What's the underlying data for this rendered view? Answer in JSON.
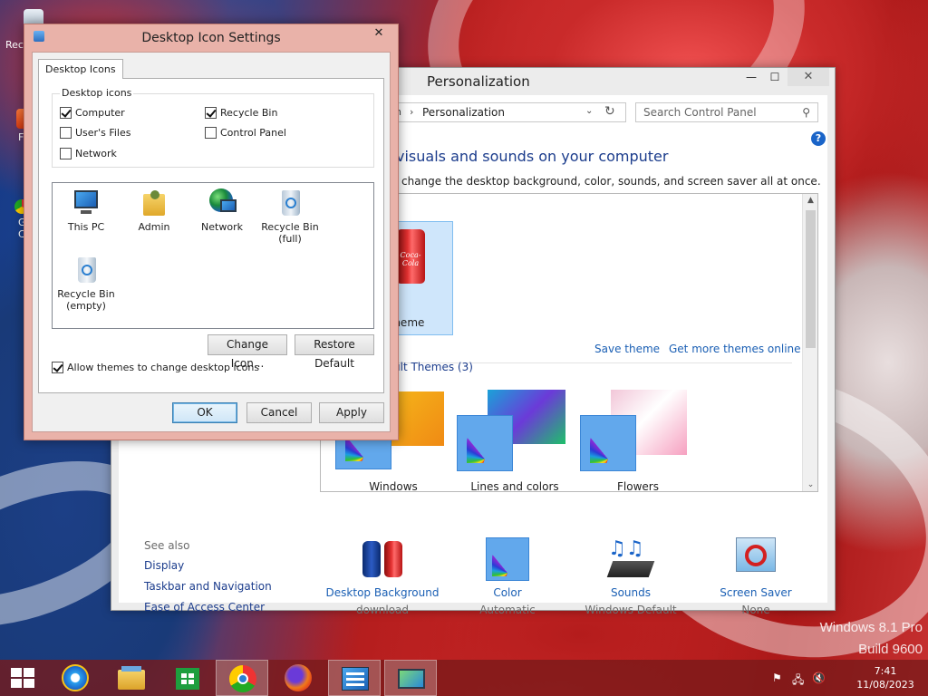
{
  "wallpaper": {
    "watermark_line1": "Windows 8.1 Pro",
    "watermark_line2": "Build 9600"
  },
  "desktop_icons": [
    {
      "label": "Rec",
      "icon": "recycle-bin-icon"
    },
    {
      "label": "F",
      "icon": "app-icon"
    },
    {
      "label": "G C",
      "icon": "chrome-icon"
    }
  ],
  "personalization": {
    "title": "Personalization",
    "window_controls": {
      "minimize": "—",
      "maximize": "☐",
      "close": "✕"
    },
    "address_prefix": "n",
    "address_sep": "›",
    "address_current": "Personalization",
    "search_placeholder": "Search Control Panel",
    "help": "?",
    "heading": "visuals and sounds on your computer",
    "subheading": "change the desktop background, color, sounds, and screen saver all at once.",
    "my_themes_caption": "Theme",
    "save_theme": "Save theme",
    "get_more_themes": "Get more themes online",
    "default_themes_heading": "ult Themes (3)",
    "themes": [
      {
        "name": "Windows"
      },
      {
        "name": "Lines and colors"
      },
      {
        "name": "Flowers"
      }
    ],
    "see_also": {
      "heading": "See also",
      "links": [
        "Display",
        "Taskbar and Navigation",
        "Ease of Access Center"
      ]
    },
    "bottom": [
      {
        "title": "Desktop Background",
        "sub": "download",
        "icon": "desktop-background-icon"
      },
      {
        "title": "Color",
        "sub": "Automatic",
        "icon": "color-icon"
      },
      {
        "title": "Sounds",
        "sub": "Windows Default",
        "icon": "sounds-icon"
      },
      {
        "title": "Screen Saver",
        "sub": "None",
        "icon": "screen-saver-icon"
      }
    ],
    "can_label": "Coca-Cola"
  },
  "dialog": {
    "title": "Desktop Icon Settings",
    "close": "✕",
    "tab": "Desktop Icons",
    "group_label": "Desktop icons",
    "checkboxes": [
      {
        "label": "Computer",
        "checked": true
      },
      {
        "label": "Recycle Bin",
        "checked": true
      },
      {
        "label": "User's Files",
        "checked": false
      },
      {
        "label": "Control Panel",
        "checked": false
      },
      {
        "label": "Network",
        "checked": false
      }
    ],
    "icons": [
      {
        "label": "This PC",
        "icon": "this-pc-icon"
      },
      {
        "label": "Admin",
        "icon": "user-folder-icon"
      },
      {
        "label": "Network",
        "icon": "network-icon"
      },
      {
        "label": "Recycle Bin (full)",
        "icon": "recycle-bin-full-icon"
      },
      {
        "label": "Recycle Bin (empty)",
        "icon": "recycle-bin-empty-icon"
      }
    ],
    "change_icon": "Change Icon...",
    "restore_default": "Restore Default",
    "allow_themes": {
      "label": "Allow themes to change desktop icons",
      "checked": true
    },
    "ok": "OK",
    "cancel": "Cancel",
    "apply": "Apply"
  },
  "taskbar": {
    "apps": [
      {
        "name": "start",
        "icon": "windows-start-icon"
      },
      {
        "name": "internet-explorer",
        "icon": "internet-explorer-icon"
      },
      {
        "name": "file-explorer",
        "icon": "file-explorer-icon"
      },
      {
        "name": "store",
        "icon": "store-icon"
      },
      {
        "name": "chrome",
        "icon": "chrome-icon"
      },
      {
        "name": "firefox",
        "icon": "firefox-icon"
      },
      {
        "name": "control-panel",
        "icon": "control-panel-icon"
      },
      {
        "name": "personalization",
        "icon": "personalization-icon"
      }
    ],
    "time": "7:41",
    "date": "11/08/2023",
    "tray_flag": "⚑",
    "tray_network": "🖧",
    "tray_volume": "🔇"
  }
}
